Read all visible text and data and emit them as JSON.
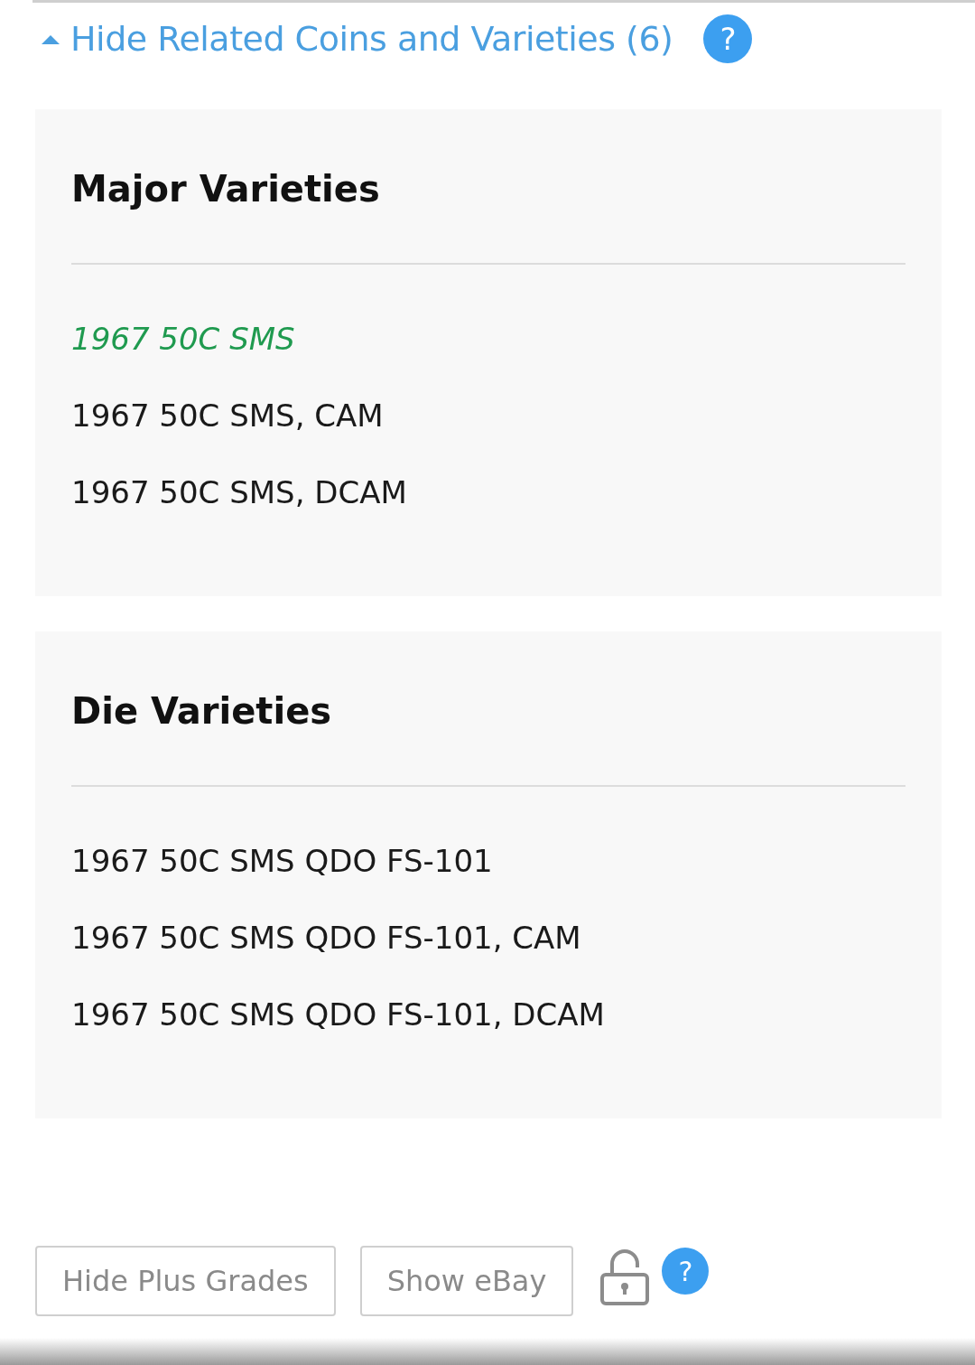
{
  "toggle": {
    "label": "Hide Related Coins and Varieties (6)",
    "expanded": true,
    "help": "?"
  },
  "sections": [
    {
      "title": "Major Varieties",
      "items": [
        {
          "label": "1967 50C SMS",
          "selected": true
        },
        {
          "label": "1967 50C SMS, CAM",
          "selected": false
        },
        {
          "label": "1967 50C SMS, DCAM",
          "selected": false
        }
      ]
    },
    {
      "title": "Die Varieties",
      "items": [
        {
          "label": "1967 50C SMS QDO FS-101",
          "selected": false
        },
        {
          "label": "1967 50C SMS QDO FS-101, CAM",
          "selected": false
        },
        {
          "label": "1967 50C SMS QDO FS-101, DCAM",
          "selected": false
        }
      ]
    }
  ],
  "buttons": [
    "Hide Plus Grades",
    "Show eBay"
  ],
  "lock": {
    "locked": false
  },
  "help": "?"
}
